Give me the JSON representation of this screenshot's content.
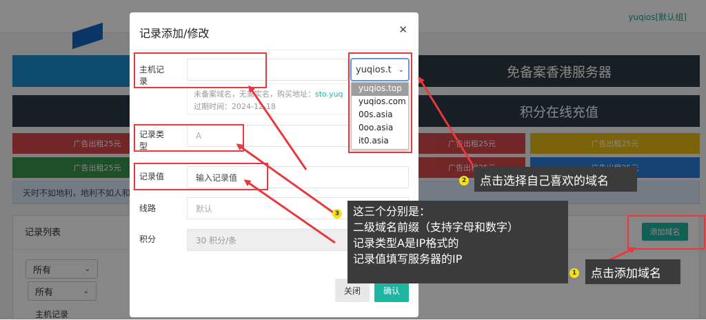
{
  "header": {
    "user_label": "yuqios[默认组]"
  },
  "banners": [
    {
      "text": "免备案香港服务器",
      "color": "#2d3a45"
    },
    {
      "text": "积分在线充值",
      "color": "#2d3a45"
    }
  ],
  "ads": {
    "row1": [
      {
        "text": "广告出租25元",
        "color": "#d63b3e"
      },
      {
        "text": "广告出租25元",
        "color": "#d63b3e"
      },
      {
        "text": "广告出租25元",
        "color": "#2a8e3e"
      },
      {
        "text": "广告出租25元",
        "color": "#e6b800"
      }
    ],
    "row2": [
      {
        "text": "广告出租25元",
        "color": "#2a8e3e"
      },
      {
        "text": "广告出租25元",
        "color": "#d63b3e"
      },
      {
        "text": "广告出租25元",
        "color": "#d63b3e"
      },
      {
        "text": "广告出租25元",
        "color": "#1a73d9"
      }
    ]
  },
  "notice": "天时不如地利，地利不如人和。",
  "records": {
    "title": "记录列表",
    "add_button": "添加域名",
    "filter1": "所有",
    "filter2": "所有",
    "col_host": "主机记录"
  },
  "modal": {
    "title": "记录添加/修改",
    "close": "✕",
    "host_label": "主机记\n录",
    "domain_select": "yuqios.t",
    "domain_options": [
      "yuqios.top",
      "yuqios.com",
      "00s.asia",
      "0oo.asia",
      "it0.asia"
    ],
    "hint_line1": "未备案域名，无需实名，购买地址：",
    "hint_link": "sto.yuq",
    "hint_line2": "过期时间：2024-12-18",
    "type_label": "记录类\n型",
    "type_value": "A",
    "value_label": "记录值",
    "value_placeholder": "输入记录值",
    "route_label": "线路",
    "route_value": "默认",
    "points_label": "积分",
    "points_value": "30 积分/条",
    "cancel": "关闭",
    "confirm": "确认"
  },
  "annotations": {
    "callout1": {
      "num": "1",
      "text": "点击添加域名"
    },
    "callout2": {
      "num": "2",
      "text": "点击选择自己喜欢的域名"
    },
    "callout3": {
      "num": "3",
      "line1": "这三个分别是：",
      "line2": "二级域名前缀（支持字母和数字）",
      "line3": "记录类型A是IP格式的",
      "line4": "记录值填写服务器的IP"
    }
  },
  "colors": {
    "accent": "#1fb5a3",
    "annotation_red": "#e8383d"
  }
}
